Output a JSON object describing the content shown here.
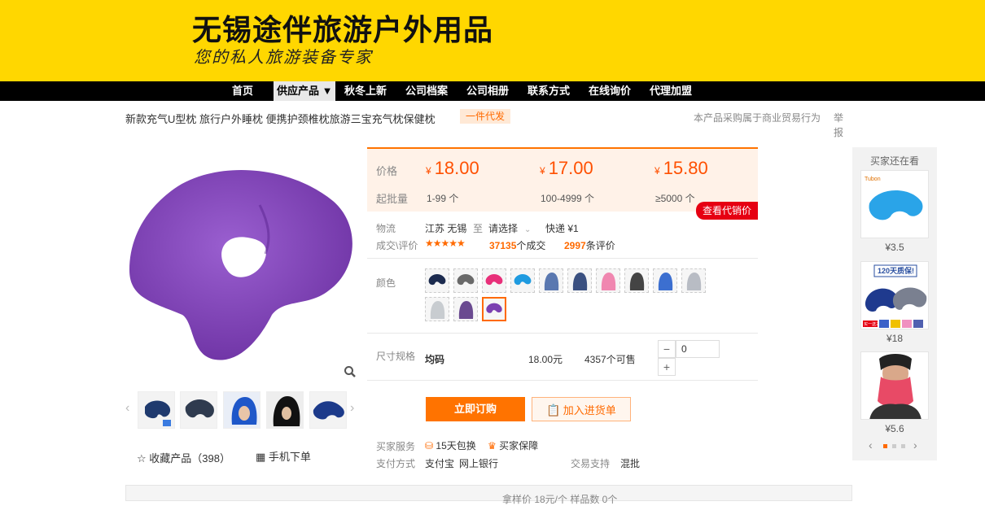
{
  "header": {
    "shop_name": "无锡途伴旅游户外用品",
    "slogan": "您的私人旅游装备专家"
  },
  "nav": {
    "items": [
      "首页",
      "供应产品 ▼",
      "秋冬上新",
      "公司档案",
      "公司相册",
      "联系方式",
      "在线询价",
      "代理加盟"
    ]
  },
  "product": {
    "title": "新款充气U型枕 旅行户外睡枕 便携护颈椎枕旅游三宝充气枕保健枕",
    "badge": "一件代发",
    "trade_note": "本产品采购属于商业贸易行为",
    "report": "举报"
  },
  "price": {
    "label_price": "价格",
    "label_moq": "起批量",
    "tiers": [
      {
        "price": "18.00",
        "qty": "1-99 个"
      },
      {
        "price": "17.00",
        "qty": "100-4999 个"
      },
      {
        "price": "15.80",
        "qty": "≥5000 个"
      }
    ],
    "currency": "¥",
    "agent_button": "查看代销价"
  },
  "logistics": {
    "label": "物流",
    "from": "江苏 无锡",
    "to_word": "至",
    "select": "请选择",
    "express": "快递 ¥1"
  },
  "deals": {
    "label": "成交\\评价",
    "stars": "★★★★★",
    "sold_count": "37135",
    "sold_suffix": "个成交",
    "review_count": "2997",
    "review_suffix": "条评价"
  },
  "color": {
    "label": "颜色",
    "swatches": [
      "navy",
      "grey",
      "pink",
      "sky-blue",
      "blue-hood",
      "navy-hood",
      "pink-hood",
      "black-hood",
      "blue-hood-2",
      "light-grey-hood",
      "light-grey",
      "purple-grey",
      "purple"
    ],
    "selected_index": 12
  },
  "spec": {
    "label": "尺寸规格",
    "name": "均码",
    "price": "18.00元",
    "stock": "4357个可售",
    "quantity": "0",
    "minus": "−",
    "plus": "+"
  },
  "actions": {
    "buy": "立即订购",
    "cart": "加入进货单"
  },
  "service": {
    "label": "买家服务",
    "items": [
      "15天包换",
      "买家保障"
    ],
    "pay_label": "支付方式",
    "pay_items": [
      "支付宝",
      "网上银行"
    ],
    "trade_label": "交易支持",
    "trade_value": "混批"
  },
  "gallery": {
    "fav_label": "收藏产品（398）",
    "mobile_label": "手机下单",
    "zoom_icon": "magnifier-icon"
  },
  "side": {
    "title": "买家还在看",
    "items": [
      {
        "price": "¥3.5",
        "brand": "Tubon"
      },
      {
        "price": "¥18",
        "promo": "120天质保!",
        "promo2": "买一送三"
      },
      {
        "price": "¥5.6"
      }
    ]
  },
  "bottom": {
    "text": "拿样价  18元/个    样品数  0个"
  },
  "colors": {
    "accent": "#ff6a00",
    "banner": "#ffd700",
    "product": "#7b3fb0"
  }
}
